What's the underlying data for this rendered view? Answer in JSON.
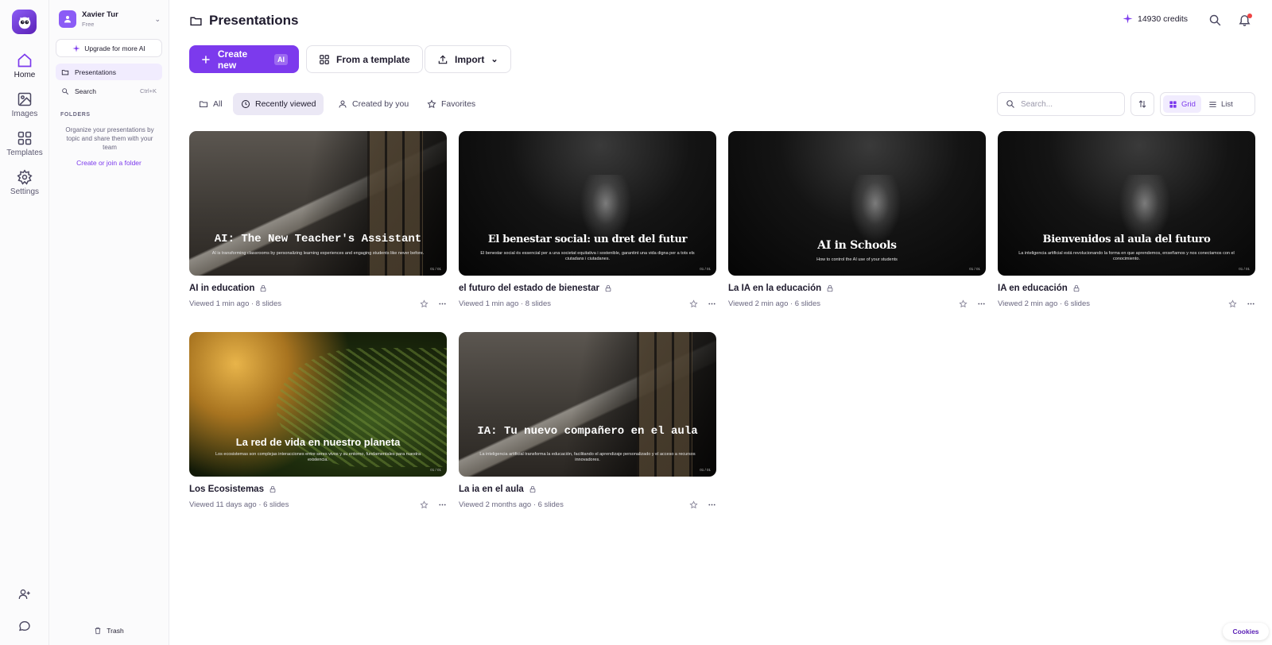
{
  "rail": {
    "items": [
      {
        "label": "Home",
        "icon": "home-icon"
      },
      {
        "label": "Images",
        "icon": "image-icon"
      },
      {
        "label": "Templates",
        "icon": "grid-icon"
      },
      {
        "label": "Settings",
        "icon": "gear-icon"
      }
    ],
    "bottom_icons": [
      "add-user-icon",
      "chat-icon"
    ]
  },
  "user": {
    "name": "Xavier Tur",
    "plan": "Free"
  },
  "panel": {
    "upgrade_label": "Upgrade for more AI",
    "nav": [
      {
        "label": "Presentations",
        "icon": "folder-icon"
      },
      {
        "label": "Search",
        "icon": "search-icon",
        "shortcut": "Ctrl+K"
      }
    ],
    "folders_heading": "FOLDERS",
    "folders_text": "Organize your presentations by topic and share them with your team",
    "folders_link": "Create or join a folder",
    "trash_label": "Trash"
  },
  "header": {
    "title": "Presentations",
    "credits": "14930 credits"
  },
  "actions": {
    "create_new": "Create new",
    "ai_tag": "AI",
    "from_template": "From a template",
    "import": "Import"
  },
  "filters": [
    {
      "label": "All",
      "icon": "folder-icon"
    },
    {
      "label": "Recently viewed",
      "icon": "clock-icon",
      "active": true
    },
    {
      "label": "Created by you",
      "icon": "person-icon"
    },
    {
      "label": "Favorites",
      "icon": "star-icon"
    }
  ],
  "search": {
    "placeholder": "Search..."
  },
  "view": {
    "grid": "Grid",
    "list": "List",
    "selected": "Grid"
  },
  "cards": [
    {
      "title": "AI in education",
      "meta": "Viewed 1 min ago · 8 slides",
      "slide_title": "AI: The New Teacher's Assistant",
      "slide_sub": "AI is transforming classrooms by personalizing learning experiences and engaging students like never before.",
      "slide_num": "01 / 01",
      "style": "concrete-mono"
    },
    {
      "title": "el futuro del estado de bienestar",
      "meta": "Viewed 1 min ago · 8 slides",
      "slide_title": "El benestar social: un dret del futur",
      "slide_sub": "El benestar social és essencial per a una societat equitativa i sostenible, garantint una vida digna per a tots els ciutadans i ciutadanes.",
      "slide_num": "01 / 01",
      "style": "dark-serif"
    },
    {
      "title": "La IA en la educación",
      "meta": "Viewed 2 min ago · 6 slides",
      "slide_title": "AI in Schools",
      "slide_sub": "How to control the AI use of your students",
      "slide_num": "01 / 01",
      "style": "dark-serif"
    },
    {
      "title": "IA en educación",
      "meta": "Viewed 2 min ago · 6 slides",
      "slide_title": "Bienvenidos al aula del futuro",
      "slide_sub": "La inteligencia artificial está revolucionando la forma en que aprendemos, enseñamos y nos conectamos con el conocimiento.",
      "slide_num": "01 / 01",
      "style": "dark-serif"
    },
    {
      "title": "Los Ecosistemas",
      "meta": "Viewed 11 days ago · 6 slides",
      "slide_title": "La red de vida en nuestro planeta",
      "slide_sub": "Los ecosistemas son complejas interacciones entre seres vivos y su entorno, fundamentales para nuestra existencia.",
      "slide_num": "01 / 01",
      "style": "fern-sans"
    },
    {
      "title": "La ia en el aula",
      "meta": "Viewed 2 months ago · 6 slides",
      "slide_title": "IA: Tu nuevo compañero en el aula",
      "slide_sub": "La inteligencia artificial transforma la educación, facilitando el aprendizaje personalizado y el acceso a recursos innovadores.",
      "slide_num": "01 / 01",
      "style": "concrete-mono"
    }
  ],
  "cookies_label": "Cookies",
  "colors": {
    "accent": "#7c3aed",
    "accent_bg": "#f1ecfe",
    "text": "#1f1b2e",
    "muted": "#6a6780"
  }
}
